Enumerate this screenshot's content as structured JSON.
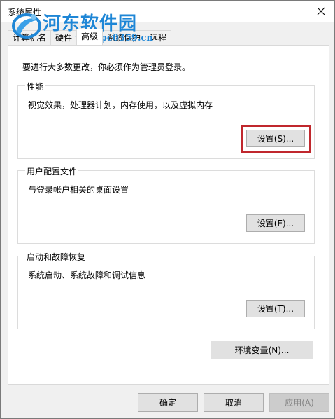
{
  "window": {
    "title": "系统属性"
  },
  "watermark": {
    "title": "河东软件园",
    "url": "www.pc0359.cn"
  },
  "tabs": [
    {
      "label": "计算机名",
      "active": false
    },
    {
      "label": "硬件",
      "active": false
    },
    {
      "label": "高级",
      "active": true
    },
    {
      "label": "系统保护",
      "active": false
    },
    {
      "label": "远程",
      "active": false
    }
  ],
  "admin_note": "要进行大多数更改，你必须作为管理员登录。",
  "performance": {
    "label": "性能",
    "desc": "视觉效果，处理器计划，内存使用，以及虚拟内存",
    "button": "设置(S)..."
  },
  "user_profiles": {
    "label": "用户配置文件",
    "desc": "与登录帐户相关的桌面设置",
    "button": "设置(E)..."
  },
  "startup_recovery": {
    "label": "启动和故障恢复",
    "desc": "系统启动、系统故障和调试信息",
    "button": "设置(T)..."
  },
  "env_button": "环境变量(N)...",
  "footer": {
    "ok": "确定",
    "cancel": "取消",
    "apply": "应用(A)"
  },
  "colors": {
    "highlight": "#c0272d",
    "watermark": "#1e86d6"
  }
}
